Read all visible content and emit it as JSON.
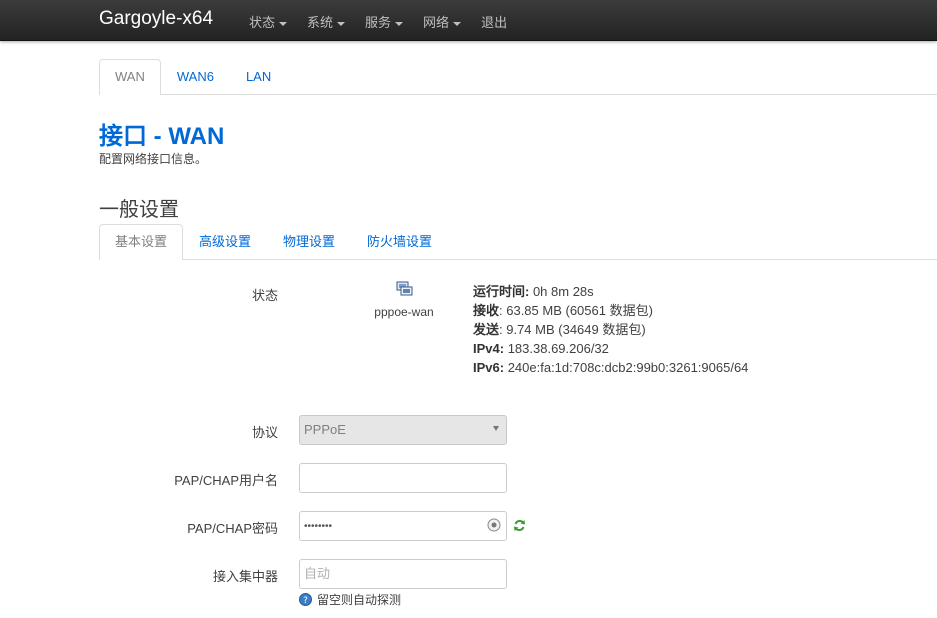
{
  "app": {
    "brand": "Gargoyle-x64",
    "menu": [
      "状态",
      "系统",
      "服务",
      "网络",
      "退出"
    ]
  },
  "top_tabs": [
    "WAN",
    "WAN6",
    "LAN"
  ],
  "page": {
    "title": "接口 - WAN",
    "description": "配置网络接口信息。"
  },
  "section": {
    "title": "一般设置",
    "tabs": [
      "基本设置",
      "高级设置",
      "物理设置",
      "防火墙设置"
    ]
  },
  "status": {
    "label": "状态",
    "interface": "pppoe-wan",
    "uptime_label": "运行时间:",
    "uptime_value": " 0h 8m 28s",
    "rx_label": "接收",
    "rx_value": ": 63.85 MB (60561 数据包)",
    "tx_label": "发送",
    "tx_value": ": 9.74 MB (34649 数据包)",
    "ipv4_label": "IPv4:",
    "ipv4_value": " 183.38.69.206/32",
    "ipv6_label": "IPv6:",
    "ipv6_value": " 240e:fa:1d:708c:dcb2:99b0:3261:9065/64"
  },
  "form": {
    "protocol_label": "协议",
    "protocol_value": "PPPoE",
    "username_label": "PAP/CHAP用户名",
    "username_value": "",
    "password_label": "PAP/CHAP密码",
    "password_value": "••••••••",
    "concentrator_label": "接入集中器",
    "concentrator_placeholder": "自动",
    "concentrator_hint": "留空则自动探测"
  },
  "colors": {
    "navbar": "#2a2a2a",
    "link": "#0069d6",
    "title": "#0069d6"
  }
}
